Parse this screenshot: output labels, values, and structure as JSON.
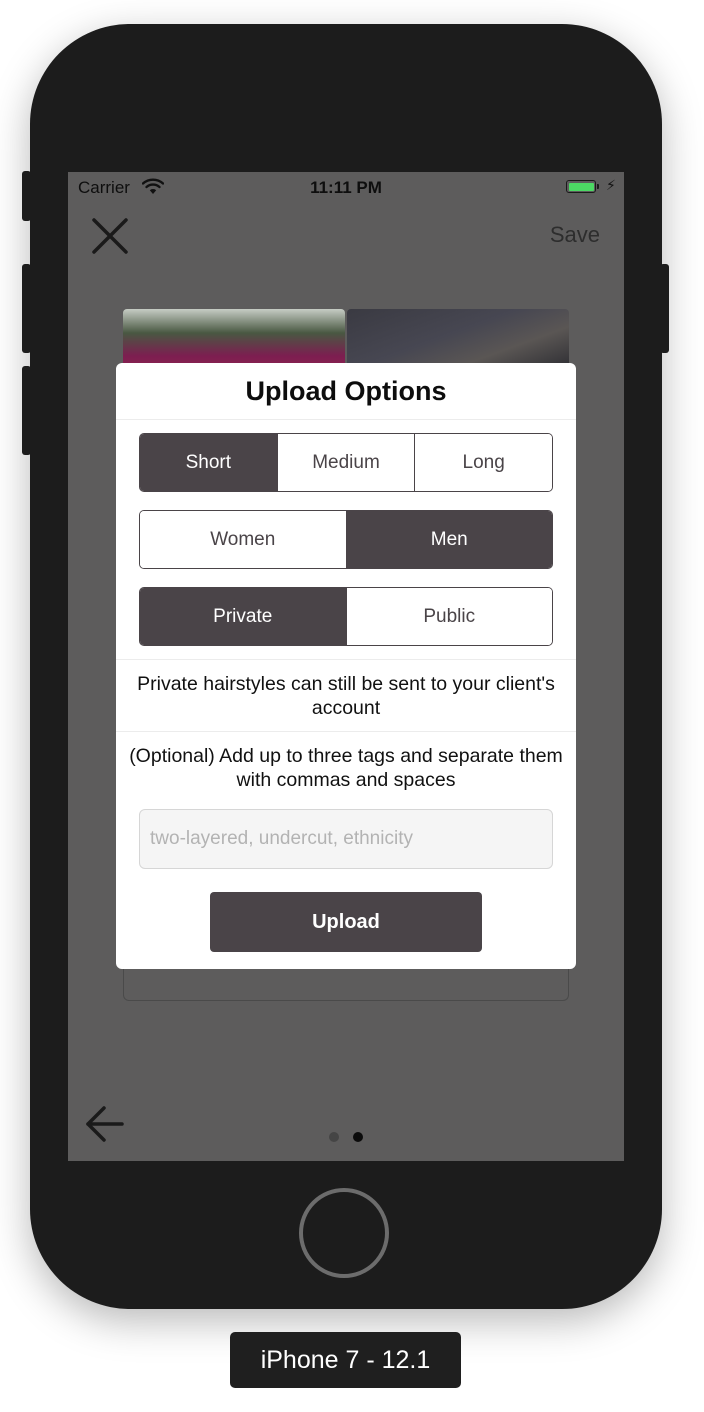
{
  "status_bar": {
    "carrier": "Carrier",
    "time": "11:11 PM",
    "wifi_icon": "wifi-icon",
    "battery_icon": "battery-icon",
    "charging_icon": "bolt-icon"
  },
  "nav": {
    "close_icon": "close-icon",
    "save_label": "Save",
    "back_icon": "arrow-left-icon"
  },
  "modal": {
    "title": "Upload Options",
    "length_options": [
      {
        "label": "Short",
        "selected": true
      },
      {
        "label": "Medium",
        "selected": false
      },
      {
        "label": "Long",
        "selected": false
      }
    ],
    "gender_options": [
      {
        "label": "Women",
        "selected": false
      },
      {
        "label": "Men",
        "selected": true
      }
    ],
    "visibility_options": [
      {
        "label": "Private",
        "selected": true
      },
      {
        "label": "Public",
        "selected": false
      }
    ],
    "private_note": "Private hairstyles can still be sent to your client's account",
    "tags_instruction": "(Optional) Add up to three tags and separate them with commas and spaces",
    "tags_input": {
      "value": "",
      "placeholder": "two-layered, undercut, ethnicity"
    },
    "upload_label": "Upload"
  },
  "pager": {
    "count": 2,
    "active_index": 1
  },
  "device_label": "iPhone 7 - 12.1",
  "colors": {
    "segment_selected": "#4a4448",
    "overlay": "#5d5c5c",
    "battery_fill": "#4cd964"
  }
}
